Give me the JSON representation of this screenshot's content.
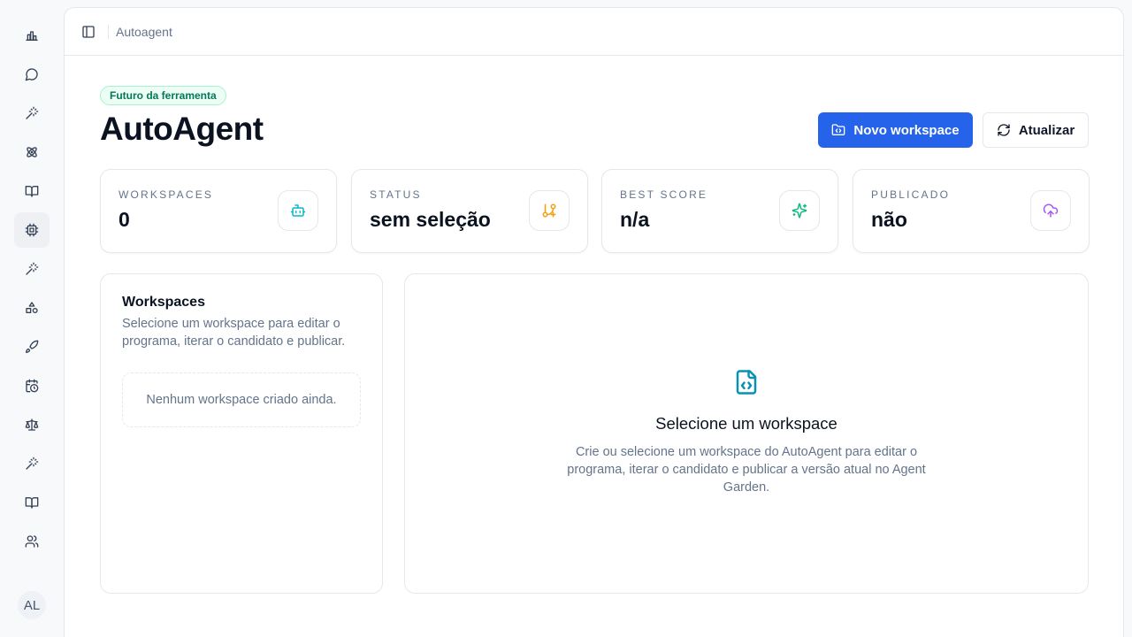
{
  "rail": {
    "items": [
      {
        "icon": "bar-chart-icon"
      },
      {
        "icon": "chat-bubble-icon"
      },
      {
        "icon": "magic-wand-icon"
      },
      {
        "icon": "atom-icon"
      },
      {
        "icon": "book-open-icon"
      },
      {
        "icon": "cpu-icon",
        "active": true
      },
      {
        "icon": "magic-wand-icon"
      },
      {
        "icon": "shapes-icon"
      },
      {
        "icon": "rocket-icon"
      },
      {
        "icon": "calendar-clock-icon"
      },
      {
        "icon": "scale-icon"
      },
      {
        "icon": "magic-wand-icon"
      },
      {
        "icon": "book-open-icon"
      },
      {
        "icon": "users-icon"
      }
    ],
    "avatar_initials": "AL"
  },
  "topbar": {
    "breadcrumb": "Autoagent"
  },
  "header": {
    "badge": "Futuro da ferramenta",
    "title": "AutoAgent",
    "new_workspace_label": "Novo workspace",
    "refresh_label": "Atualizar"
  },
  "stats": [
    {
      "label": "WORKSPACES",
      "value": "0",
      "icon": "bot-icon",
      "color": "#06b6d4"
    },
    {
      "label": "STATUS",
      "value": "sem seleção",
      "icon": "git-branch-plus-icon",
      "color": "#f59e0b"
    },
    {
      "label": "BEST SCORE",
      "value": "n/a",
      "icon": "sparkles-icon",
      "color": "#10b981"
    },
    {
      "label": "PUBLICADO",
      "value": "não",
      "icon": "cloud-upload-icon",
      "color": "#a855f7"
    }
  ],
  "workspaces": {
    "title": "Workspaces",
    "description": "Selecione um workspace para editar o programa, iterar o candidato e publicar.",
    "empty": "Nenhum workspace criado ainda."
  },
  "detail": {
    "icon": "file-code-icon",
    "title": "Selecione um workspace",
    "description": "Crie ou selecione um workspace do AutoAgent para editar o programa, iterar o candidato e publicar a versão atual no Agent Garden."
  },
  "colors": {
    "primary": "#2563eb",
    "badge_bg": "#ecfdf5",
    "badge_text": "#047857"
  }
}
